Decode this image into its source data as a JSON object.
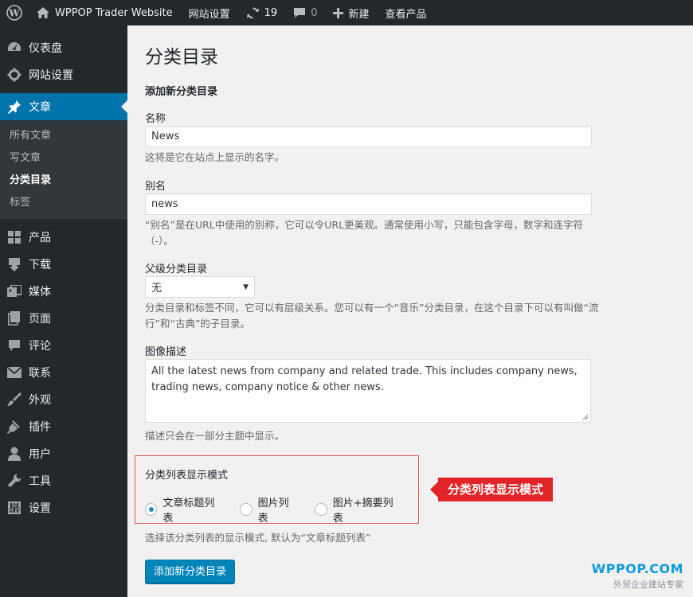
{
  "admin_bar": {
    "site_name": "WPPOP Trader Website",
    "site_settings": "网站设置",
    "updates_count": "19",
    "comments_count": "0",
    "new_label": "新建",
    "view_product": "查看产品"
  },
  "sidebar": {
    "items": [
      {
        "label": "仪表盘",
        "icon": "dashboard-icon"
      },
      {
        "label": "网站设置",
        "icon": "gear-icon"
      },
      {
        "label": "文章",
        "icon": "pin-icon"
      }
    ],
    "submenu": [
      "所有文章",
      "写文章",
      "分类目录",
      "标签"
    ],
    "items_after": [
      {
        "label": "产品",
        "icon": "grid-icon"
      },
      {
        "label": "下载",
        "icon": "download-icon"
      },
      {
        "label": "媒体",
        "icon": "media-icon"
      },
      {
        "label": "页面",
        "icon": "page-icon"
      },
      {
        "label": "评论",
        "icon": "comment-icon"
      },
      {
        "label": "联系",
        "icon": "mail-icon"
      },
      {
        "label": "外观",
        "icon": "brush-icon"
      },
      {
        "label": "插件",
        "icon": "plugin-icon"
      },
      {
        "label": "用户",
        "icon": "user-icon"
      },
      {
        "label": "工具",
        "icon": "wrench-icon"
      },
      {
        "label": "设置",
        "icon": "settings-icon"
      }
    ]
  },
  "main": {
    "page_title": "分类目录",
    "section_title": "添加新分类目录",
    "name": {
      "label": "名称",
      "value": "News",
      "help": "这将是它在站点上显示的名字。"
    },
    "slug": {
      "label": "别名",
      "value": "news",
      "help_line1": "“别名”是在URL中使用的别称，它可以令URL更美观。通常使用小写，只能包含字母，数字和连字符",
      "help_line2": "（-）。"
    },
    "parent": {
      "label": "父级分类目录",
      "selected": "无",
      "help_line1": "分类目录和标签不同，它可以有层级关系。您可以有一个“音乐”分类目录，在这个目录下可以有叫做“流",
      "help_line2": "行”和“古典”的子目录。"
    },
    "description": {
      "label": "图像描述",
      "value": "All the latest news from company and related trade. This includes company news, trading news, company notice & other news.",
      "help": "描述只会在一部分主题中显示。"
    },
    "display_mode": {
      "title": "分类列表显示模式",
      "options": [
        "文章标题列表",
        "图片列表",
        "图片+摘要列表"
      ],
      "selected_index": 0,
      "help": "选择该分类列表的显示模式, 默认为“文章标题列表”"
    },
    "callout": "分类列表显示模式",
    "submit_label": "添加新分类目录"
  },
  "watermark": {
    "logo": "WPPOP.COM",
    "tagline": "外贸企业建站专家"
  },
  "colors": {
    "admin_dark": "#23282d",
    "accent_blue": "#0073aa",
    "callout_red": "#e02427"
  }
}
